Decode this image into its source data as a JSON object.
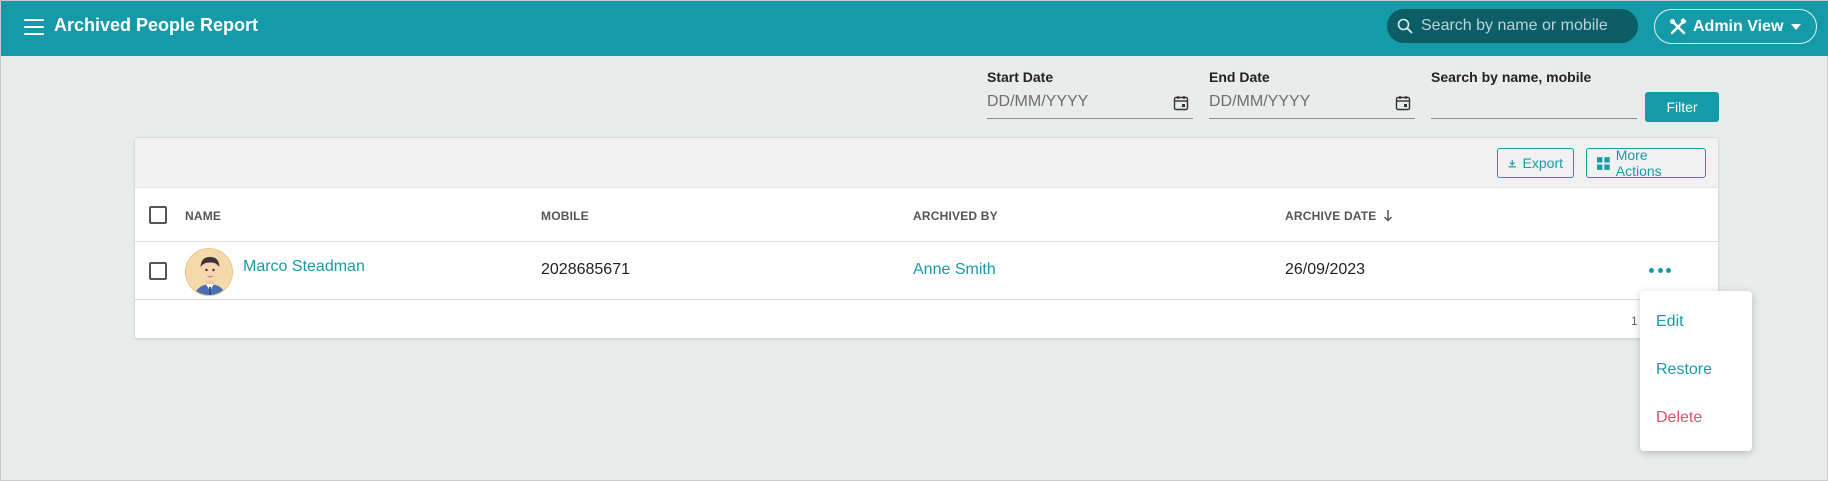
{
  "header": {
    "title": "Archived People Report",
    "search_placeholder": "Search by name or mobile",
    "view_label": "Admin View"
  },
  "filters": {
    "start_label": "Start Date",
    "start_placeholder": "DD/MM/YYYY",
    "end_label": "End Date",
    "end_placeholder": "DD/MM/YYYY",
    "search_label": "Search by name, mobile",
    "search_value": "",
    "filter_button": "Filter"
  },
  "toolbar": {
    "export_label": "Export",
    "more_label": "More Actions"
  },
  "table": {
    "columns": [
      "NAME",
      "MOBILE",
      "ARCHIVED BY",
      "ARCHIVE DATE"
    ],
    "rows": [
      {
        "name": "Marco Steadman",
        "mobile": "2028685671",
        "archived_by": "Anne Smith",
        "archive_date": "26/09/2023"
      }
    ],
    "pager_text": "1"
  },
  "row_menu": {
    "edit": "Edit",
    "restore": "Restore",
    "delete": "Delete"
  },
  "colors": {
    "primary": "#159aa8",
    "header_search_bg": "#0c5d65",
    "danger": "#e4506a"
  }
}
